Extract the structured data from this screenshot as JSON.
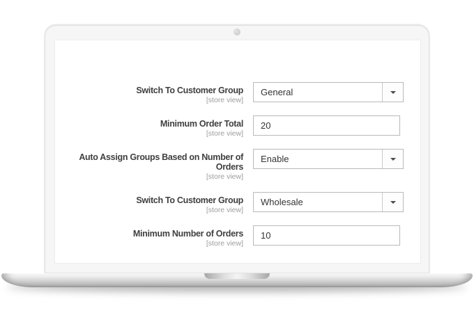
{
  "device": {
    "type": "laptop-mockup"
  },
  "icons": {
    "select_caret": "▾",
    "webcam": "gray-dot"
  },
  "colors": {
    "bezel": "#f6f6f6",
    "screen": "#ffffff",
    "field_border": "#b9b9b9",
    "label_text": "#3f3f3f",
    "scope_text": "#9d9d9d",
    "base_metal": "#c9c9c9",
    "caret": "#514943"
  },
  "form": {
    "fields": [
      {
        "label": "Switch To Customer Group",
        "scope": "[store view]",
        "control": "select",
        "value": "General"
      },
      {
        "label": "Minimum Order Total",
        "scope": "[store view]",
        "control": "text-input",
        "value": "20"
      },
      {
        "label": "Auto Assign Groups Based on Number of Orders",
        "scope": "[store view]",
        "control": "select",
        "value": "Enable"
      },
      {
        "label": "Switch To Customer Group",
        "scope": "[store view]",
        "control": "select",
        "value": "Wholesale"
      },
      {
        "label": "Minimum Number of Orders",
        "scope": "[store view]",
        "control": "text-input",
        "value": "10"
      }
    ]
  }
}
